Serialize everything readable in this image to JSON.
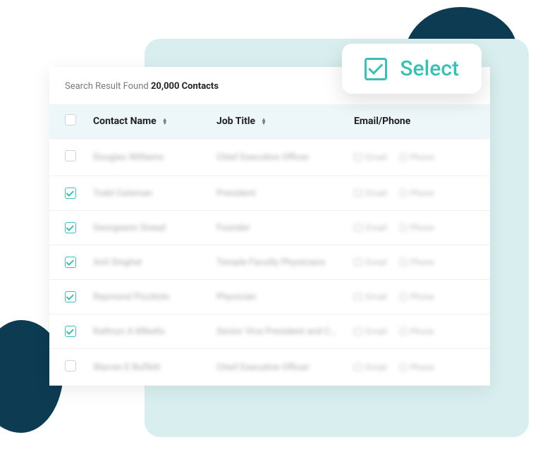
{
  "colors": {
    "accent": "#3bbfb4",
    "dark": "#0d3b52"
  },
  "selectPill": {
    "label": "Select"
  },
  "resultLine": {
    "prefix": "Search Result Found ",
    "count": "20,000 Contacts"
  },
  "columns": {
    "name": "Contact Name",
    "title": "Job Title",
    "email": "Email/Phone"
  },
  "contactLabels": {
    "email": "Email",
    "phone": "Phone"
  },
  "rows": [
    {
      "checked": false,
      "name": "Douglas Williams",
      "title": "Chief Executive Officer"
    },
    {
      "checked": true,
      "name": "Todd Coleman",
      "title": "President"
    },
    {
      "checked": true,
      "name": "Georgeann Snead",
      "title": "Founder"
    },
    {
      "checked": true,
      "name": "Anil Singhal",
      "title": "Temple Faculty Physicians"
    },
    {
      "checked": true,
      "name": "Raymond Pizzitolo",
      "title": "Physician"
    },
    {
      "checked": true,
      "name": "Kathryn A Mikells",
      "title": "Senior Vice President and C…"
    },
    {
      "checked": false,
      "name": "Warren E Buffett",
      "title": "Chief Executive Officer"
    }
  ]
}
